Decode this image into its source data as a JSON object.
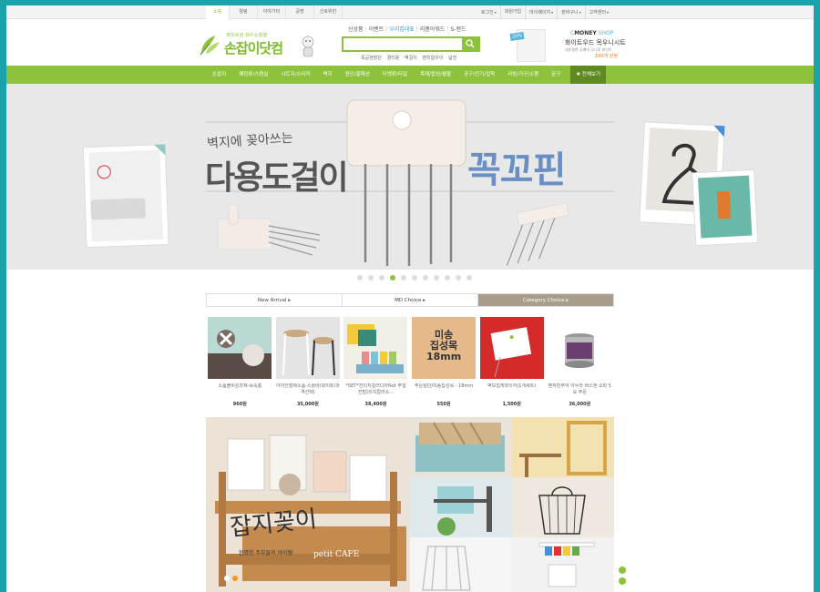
{
  "topbar": {
    "left_tabs": [
      "쇼핑",
      "릴링",
      "이야기터",
      "공방",
      "신호위반"
    ],
    "right_links": [
      "로그인",
      "회원가입",
      "마이페이지",
      "장바구니",
      "고객센터"
    ]
  },
  "logo": {
    "subtitle": "제대로된 DIY쇼핑몰",
    "name": "손잡이닷컴"
  },
  "search": {
    "keywords": [
      "신상품",
      "이벤트",
      "우리집대표",
      "리폼아워드",
      "S-랜드"
    ],
    "placeholder": "",
    "popular": [
      "목공현장단",
      "경티용",
      "벽걸이",
      "벤치합우이",
      "넓전"
    ]
  },
  "ad": {
    "badge": "20%",
    "brand_prefix": "C",
    "brand_main": "MONEY",
    "brand_suffix": " SHOP",
    "title": "화이트우드 목우니시트",
    "desc": "내추럴한 공예의 무니로 포인트",
    "limit": "100개 한정"
  },
  "nav": {
    "items": [
      "손잡이",
      "패킹류/스탠실",
      "시트지/스티커",
      "벽지",
      "원단/홈패션",
      "타벳류/타일",
      "목재/합성/웰볼",
      "공구/전기/접착",
      "리빙/가구/소품",
      "문구"
    ],
    "all_label": "전체보기"
  },
  "hero": {
    "title_small": "벽지에 꽂아쓰는",
    "title_main": "다용도걸이",
    "title_accent": "꼭꼬핀"
  },
  "slider": {
    "count": 11,
    "active": 3
  },
  "product_tabs": [
    "New Arrival",
    "MD Choice",
    "Category Choice"
  ],
  "products": [
    {
      "name": "소품볼비성과재-목속홈",
      "price": "960원"
    },
    {
      "name": "아이언철제소품-스툴바(화이트/과격선택)",
      "price": "35,000원"
    },
    {
      "name": "*SET*친티치컬러디아Not 주얼진탑(리치컬러소...",
      "price": "38,400원"
    },
    {
      "name": "주문절단/미송집성목 - 18mm",
      "price": "550원"
    },
    {
      "name": "벽모집게와이어(1개세트)",
      "price": "1,500원"
    },
    {
      "name": "벤자민무어 아우라 바스앤 쇼파 5요 주운",
      "price": "36,000원"
    }
  ],
  "product_badges": {
    "pine_line1": "미송",
    "pine_line2": "집성목",
    "pine_line3": "18mm"
  },
  "feature": {
    "title": "잡지꽂이",
    "subtitle": "현명한 주부들의 아이템",
    "crate_text": "petit CAFE"
  },
  "colors": {
    "accent": "#8dc33c",
    "frame": "#1ba3ad",
    "nav_dark": "#5e8a1f",
    "tab_active": "#a89d88"
  }
}
